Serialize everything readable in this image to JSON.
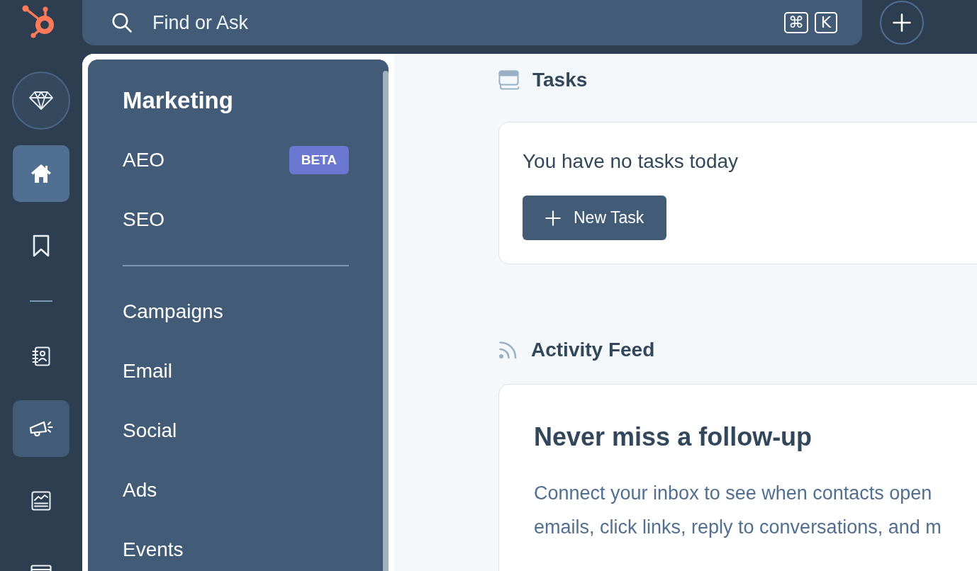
{
  "search": {
    "placeholder": "Find or Ask",
    "shortcut_keys": [
      "⌘",
      "K"
    ]
  },
  "rail": {
    "groups": [
      [
        {
          "selected": true,
          "open": false
        },
        {
          "selected": false,
          "open": false
        }
      ],
      [
        {
          "selected": false,
          "open": false
        },
        {
          "selected": false,
          "open": true
        },
        {
          "selected": false,
          "open": false
        },
        {
          "selected": false,
          "open": false
        }
      ]
    ]
  },
  "flyout": {
    "title": "Marketing",
    "sections": [
      {
        "items": [
          {
            "label": "AEO",
            "badge": "BETA"
          },
          {
            "label": "SEO"
          }
        ]
      },
      {
        "items": [
          {
            "label": "Campaigns"
          },
          {
            "label": "Email"
          },
          {
            "label": "Social"
          },
          {
            "label": "Ads"
          },
          {
            "label": "Events"
          }
        ]
      }
    ]
  },
  "tasks": {
    "title": "Tasks",
    "empty_message": "You have no tasks today",
    "button": "New Task"
  },
  "activity_feed": {
    "title": "Activity Feed",
    "card": {
      "heading": "Never miss a follow-up",
      "body_lines": [
        "Connect your inbox to see when contacts open",
        "emails, click links, reply to conversations, and m"
      ]
    }
  }
}
